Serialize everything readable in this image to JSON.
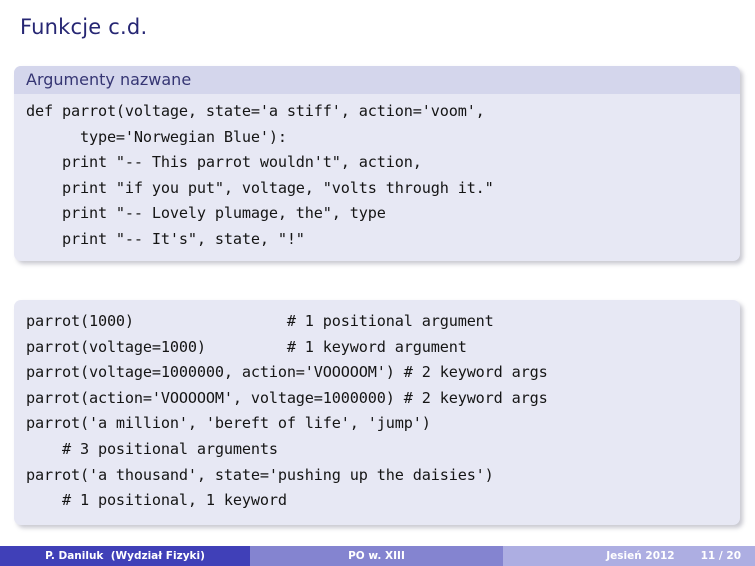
{
  "slide": {
    "title": "Funkcje c.d."
  },
  "blocks": [
    {
      "id": "keyword-args",
      "title": "Argumenty nazwane",
      "lines": [
        "def parrot(voltage, state='a stiff', action='voom',",
        "      type='Norwegian Blue'):",
        "    print \"-- This parrot wouldn't\", action,",
        "    print \"if you put\", voltage, \"volts through it.\"",
        "    print \"-- Lovely plumage, the\", type",
        "    print \"-- It's\", state, \"!\""
      ]
    },
    {
      "id": "calls",
      "title": "",
      "lines": [
        "parrot(1000)                 # 1 positional argument",
        "parrot(voltage=1000)         # 1 keyword argument",
        "parrot(voltage=1000000, action='VOOOOOM') # 2 keyword args",
        "parrot(action='VOOOOOM', voltage=1000000) # 2 keyword args",
        "parrot('a million', 'bereft of life', 'jump')",
        "    # 3 positional arguments",
        "parrot('a thousand', state='pushing up the daisies')",
        "    # 1 positional, 1 keyword"
      ]
    }
  ],
  "footer": {
    "author": "P. Daniluk  (Wydział Fizyki)",
    "course": "PO w. XIII",
    "date": "Jesień 2012",
    "page": "11 / 20"
  },
  "colors": {
    "title_text": "#262673",
    "block_title_bg": "#d4d6ec",
    "block_body_bg": "#e7e8f4",
    "footer_dark": "#4040b8",
    "footer_mid": "#8484d0",
    "footer_light": "#adaee2"
  }
}
